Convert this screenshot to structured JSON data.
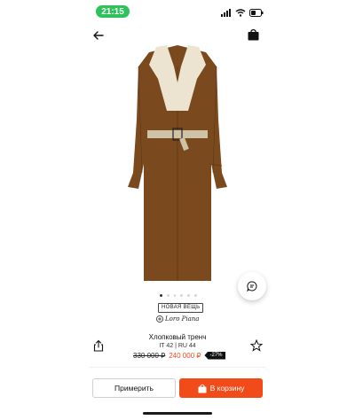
{
  "status_bar": {
    "time": "21:15"
  },
  "product": {
    "badge": "НОВАЯ ВЕЩЬ",
    "brand": "Loro Piana",
    "title": "Хлопковый тренч",
    "size": "IT 42 | RU 44",
    "old_price": "330 000 ₽",
    "new_price": "240 000 ₽",
    "discount": "-27%",
    "colors": {
      "coat": "#7a4a1e",
      "collar": "#ece4d0",
      "accent": "#f24b1a"
    }
  },
  "gallery": {
    "total": 6,
    "active_index": 0
  },
  "actions": {
    "try_on_label": "Примерить",
    "add_to_cart_label": "В корзину"
  },
  "icons": [
    "back-arrow-icon",
    "shopping-bag-icon",
    "chat-icon",
    "share-icon",
    "star-icon",
    "cart-icon",
    "signal-icon",
    "wifi-icon",
    "battery-icon",
    "brand-logo-icon"
  ]
}
